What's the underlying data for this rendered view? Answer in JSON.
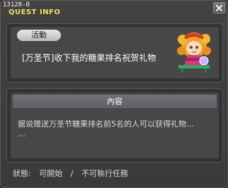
{
  "window": {
    "id_label": "13128-0",
    "title": "QUEST INFO",
    "close_icon": "close-icon"
  },
  "quest": {
    "category": "活動",
    "name": "[万圣节]收下我的糖果排名祝贺礼物",
    "npc_portrait_icon": "npc-portrait"
  },
  "content": {
    "header": "內容",
    "text_line1": "据说赠送万圣节糖果排名前5名的人可以获得礼物…",
    "text_line2": "…"
  },
  "status": {
    "label": "狀態:",
    "startable": "可開始",
    "separator": "/",
    "not_in_progress": "不可執行任務"
  }
}
